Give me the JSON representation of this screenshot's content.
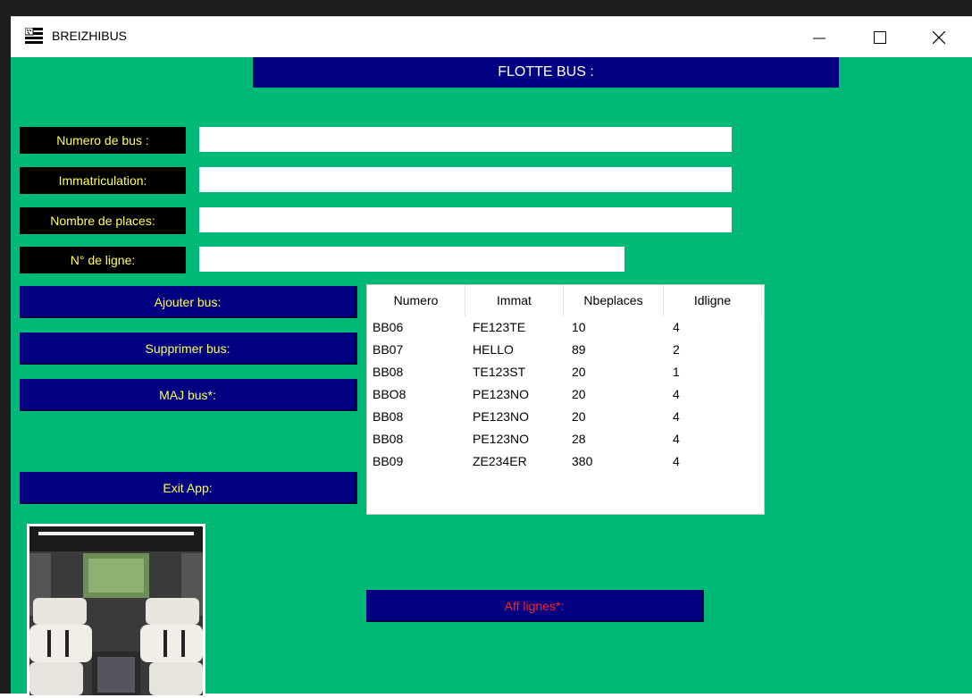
{
  "window": {
    "title": "BREIZHIBUS",
    "icon": "app-flag-icon",
    "controls": [
      "minimize-icon",
      "maximize-icon",
      "close-icon"
    ]
  },
  "header": {
    "title": "FLOTTE BUS :"
  },
  "form": {
    "numero_label": "Numero de bus :",
    "immat_label": "Immatriculation:",
    "places_label": "Nombre de places:",
    "ligne_label": "N° de ligne:",
    "numero_value": "",
    "immat_value": "",
    "places_value": "",
    "ligne_value": ""
  },
  "buttons": {
    "add": "Ajouter bus:",
    "delete": "Supprimer bus:",
    "update": "MAJ bus*:",
    "exit": "Exit App:",
    "lines": "Aff lignes*:"
  },
  "table": {
    "columns": [
      "Numero",
      "Immat",
      "Nbeplaces",
      "Idligne"
    ],
    "rows": [
      [
        "BB06",
        "FE123TE",
        "10",
        "4"
      ],
      [
        "BB07",
        "HELLO",
        "89",
        "2"
      ],
      [
        "BB08",
        "TE123ST",
        "20",
        "1"
      ],
      [
        "BBO8",
        "PE123NO",
        "20",
        "4"
      ],
      [
        "BB08",
        "PE123NO",
        "20",
        "4"
      ],
      [
        "BB08",
        "PE123NO",
        "28",
        "4"
      ],
      [
        "BB09",
        "ZE234ER",
        "380",
        "4"
      ]
    ]
  },
  "colors": {
    "background": "#00b977",
    "navy": "#000080",
    "label_text": "#ffff55",
    "alert_text": "#ff2020"
  }
}
